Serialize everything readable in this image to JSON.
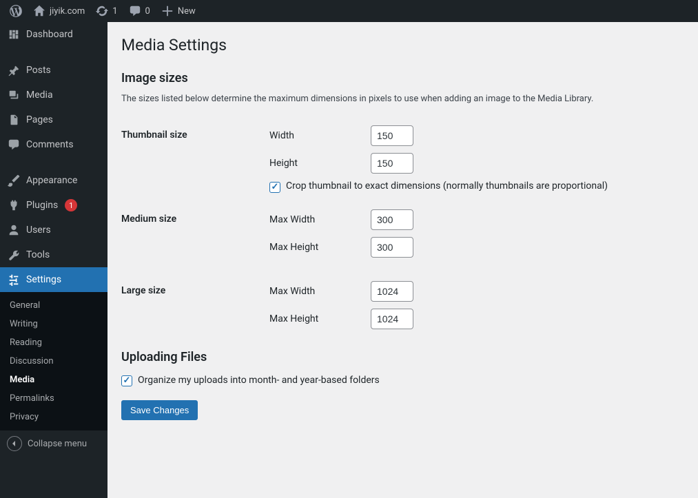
{
  "adminbar": {
    "site_name": "jiyik.com",
    "updates_count": "1",
    "comments_count": "0",
    "new_label": "New"
  },
  "sidebar": {
    "dashboard": "Dashboard",
    "posts": "Posts",
    "media": "Media",
    "pages": "Pages",
    "comments": "Comments",
    "appearance": "Appearance",
    "plugins": "Plugins",
    "plugins_badge": "1",
    "users": "Users",
    "tools": "Tools",
    "settings": "Settings",
    "submenu": {
      "general": "General",
      "writing": "Writing",
      "reading": "Reading",
      "discussion": "Discussion",
      "media": "Media",
      "permalinks": "Permalinks",
      "privacy": "Privacy"
    },
    "collapse": "Collapse menu"
  },
  "page": {
    "title": "Media Settings",
    "image_sizes_heading": "Image sizes",
    "image_sizes_desc": "The sizes listed below determine the maximum dimensions in pixels to use when adding an image to the Media Library.",
    "thumbnail": {
      "label": "Thumbnail size",
      "width_label": "Width",
      "width_value": "150",
      "height_label": "Height",
      "height_value": "150",
      "crop_label": "Crop thumbnail to exact dimensions (normally thumbnails are proportional)"
    },
    "medium": {
      "label": "Medium size",
      "maxw_label": "Max Width",
      "maxw_value": "300",
      "maxh_label": "Max Height",
      "maxh_value": "300"
    },
    "large": {
      "label": "Large size",
      "maxw_label": "Max Width",
      "maxw_value": "1024",
      "maxh_label": "Max Height",
      "maxh_value": "1024"
    },
    "uploading_heading": "Uploading Files",
    "organize_label": "Organize my uploads into month- and year-based folders",
    "save_button": "Save Changes"
  }
}
